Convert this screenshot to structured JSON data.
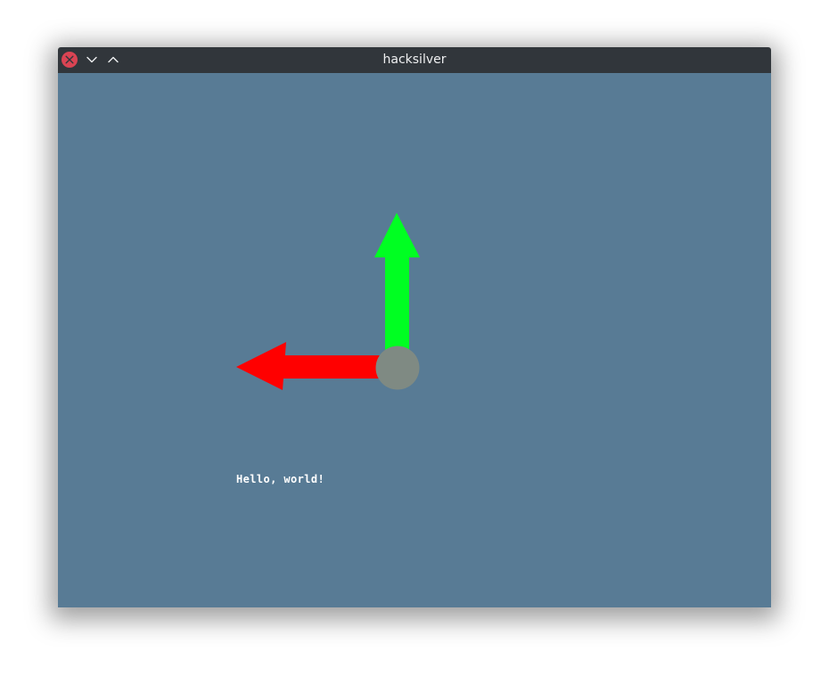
{
  "window": {
    "title": "hacksilver",
    "buttons": [
      {
        "name": "close",
        "icon": "close-icon"
      },
      {
        "name": "minimize",
        "icon": "chevron-down-icon"
      },
      {
        "name": "maximize",
        "icon": "chevron-up-icon"
      }
    ]
  },
  "colors": {
    "titlebar": "#31363b",
    "close_button": "#da4453",
    "canvas_background": "#587b95",
    "x_arrow": "#ff0000",
    "y_arrow": "#00ff22",
    "origin": "#7f8a83",
    "text": "#ffffff"
  },
  "canvas": {
    "text": "Hello, world!"
  }
}
